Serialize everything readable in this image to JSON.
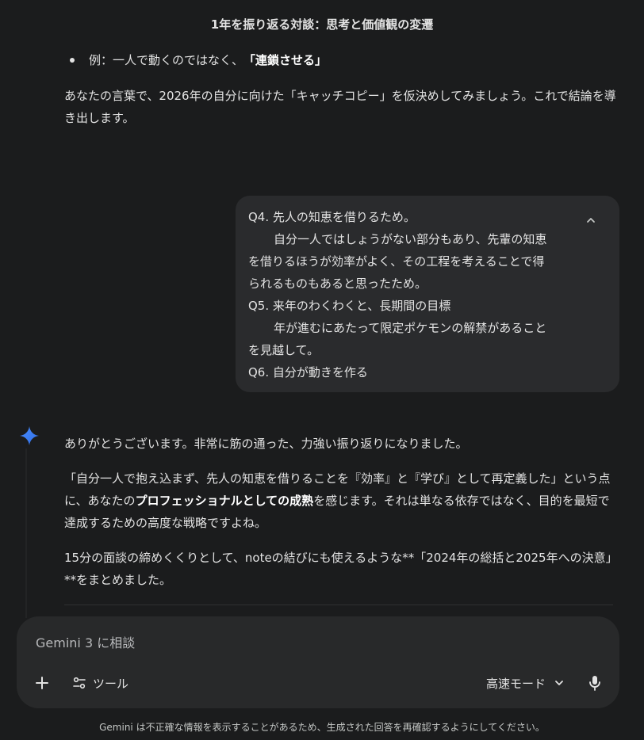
{
  "chat": {
    "title": "1年を振り返る対談：思考と価値観の変遷"
  },
  "previous": {
    "bullet_prefix": "例：一人で動くのではなく、",
    "bullet_bold": "「連鎖させる」",
    "paragraph": "あなたの言葉で、2026年の自分に向けた「キャッチコピー」を仮決めしてみましょう。これで結論を導き出します。"
  },
  "user_message": {
    "lines": [
      "Q4. 先人の知恵を借りるため。",
      "自分一人ではしょうがない部分もあり、先輩の知恵",
      "を借りるほうが効率がよく、その工程を考えることで得",
      "られるものもあると思ったため。",
      "Q5. 来年のわくわくと、長期間の目標",
      "年が進むにあたって限定ポケモンの解禁があること",
      "を見越して。",
      "Q6. 自分が動きを作る"
    ]
  },
  "response": {
    "p1": "ありがとうございます。非常に筋の通った、力強い振り返りになりました。",
    "p2_before": "「自分一人で抱え込まず、先人の知恵を借りることを『効率』と『学び』として再定義した」という点に、あなたの",
    "p2_bold": "プロフェッショナルとしての成熟",
    "p2_after": "を感じます。それは単なる依存ではなく、目的を最短で達成するための高度な戦略ですよね。",
    "p3": "15分の面談の締めくくりとして、noteの結びにも使えるような**「2024年の総括と2025年への決意」**をまとめました。"
  },
  "composer": {
    "placeholder": "Gemini 3 に相談",
    "tools_label": "ツール",
    "mode_label": "高速モード"
  },
  "footer": {
    "disclaimer": "Gemini は不正確な情報を表示することがあるため、生成された回答を再確認するようにしてください。"
  },
  "colors": {
    "background": "#1b1c1d",
    "bubble": "#2a2b2d",
    "composer": "#28292a",
    "accent_blue": "#4285f4"
  },
  "icons": [
    "gemini-spark-icon",
    "chevron-up-icon",
    "plus-icon",
    "tools-icon",
    "chevron-down-icon",
    "mic-icon"
  ]
}
